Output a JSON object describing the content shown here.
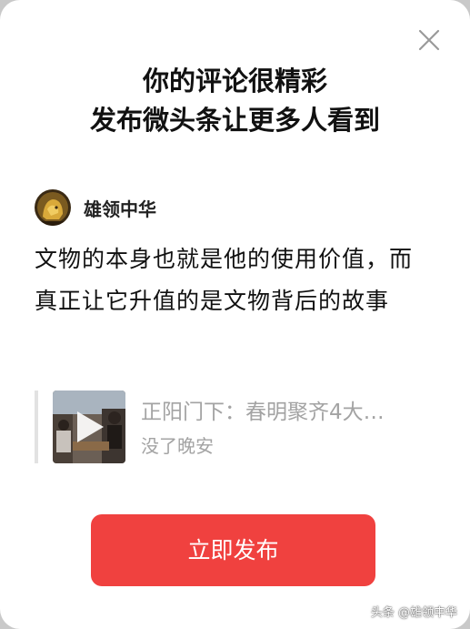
{
  "dialog": {
    "close_icon": "close-icon",
    "title_line1": "你的评论很精彩",
    "title_line2": "发布微头条让更多人看到"
  },
  "author": {
    "avatar_icon": "avatar",
    "name": "雄领中华"
  },
  "comment": {
    "text": "文物的本身也就是他的使用价值，而真正让它升值的是文物背后的故事"
  },
  "quoted_item": {
    "thumbnail_icon": "play-icon",
    "title": "正阳门下：春明聚齐4大…",
    "subtitle": "没了晚安"
  },
  "actions": {
    "publish_label": "立即发布"
  },
  "watermark": {
    "text": "头条 @雄领中华"
  },
  "colors": {
    "accent": "#f0413f",
    "muted_text": "#a3a3a3",
    "primary_text": "#111111"
  }
}
